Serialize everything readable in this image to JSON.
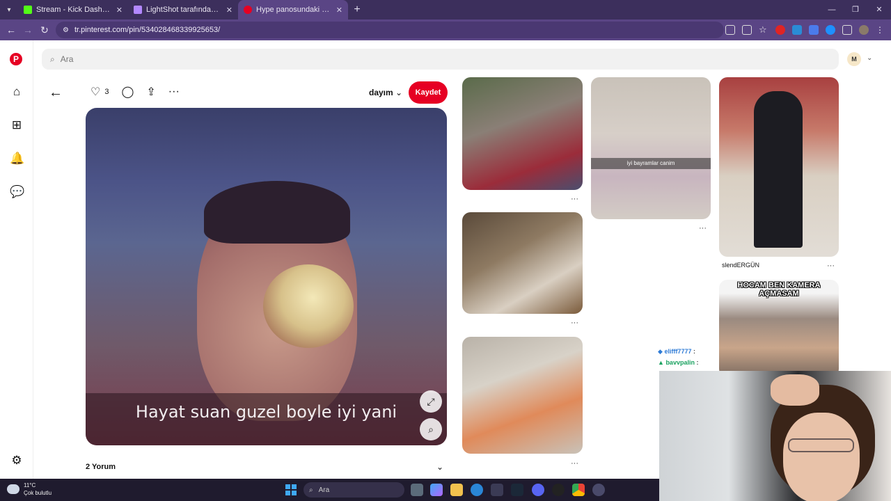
{
  "browser": {
    "tabs": [
      {
        "title": "Stream - Kick Dashboard",
        "active": false,
        "favicon_color": "#53fc18"
      },
      {
        "title": "LightShot tarafından Ekran Gör",
        "active": false,
        "favicon_color": "#b388ff"
      },
      {
        "title": "Hype panosundaki Pin",
        "active": true,
        "favicon_color": "#e60023"
      }
    ],
    "url": "tr.pinterest.com/pin/534028468339925653/",
    "accent": "#5a4585"
  },
  "pinterest": {
    "search_placeholder": "Ara",
    "avatar_initial": "M",
    "pin": {
      "like_count": "3",
      "board": "dayım",
      "save_label": "Kaydet",
      "caption": "Hayat suan guzel boyle iyi yani",
      "comments_label": "2 Yorum"
    },
    "grid": [
      {
        "overlay": "",
        "title": ""
      },
      {
        "overlay": "iyi bayramlar canim",
        "title": ""
      },
      {
        "overlay": "",
        "title": "slendERGÜN"
      },
      {
        "overlay": "",
        "title": ""
      },
      {
        "overlay": "HOCAM BEN KAMERA AÇMASAM",
        "title": ""
      },
      {
        "overlay": "",
        "title": ""
      }
    ],
    "brand_color": "#e60023"
  },
  "stream_overlay": {
    "chat": [
      {
        "user": "elifff7777",
        "color": "#2e7bd6"
      },
      {
        "user": "bavvpalin",
        "color": "#1aa260"
      }
    ]
  },
  "taskbar": {
    "temperature": "11°C",
    "weather": "Çok bulutlu",
    "search": "Ara"
  }
}
